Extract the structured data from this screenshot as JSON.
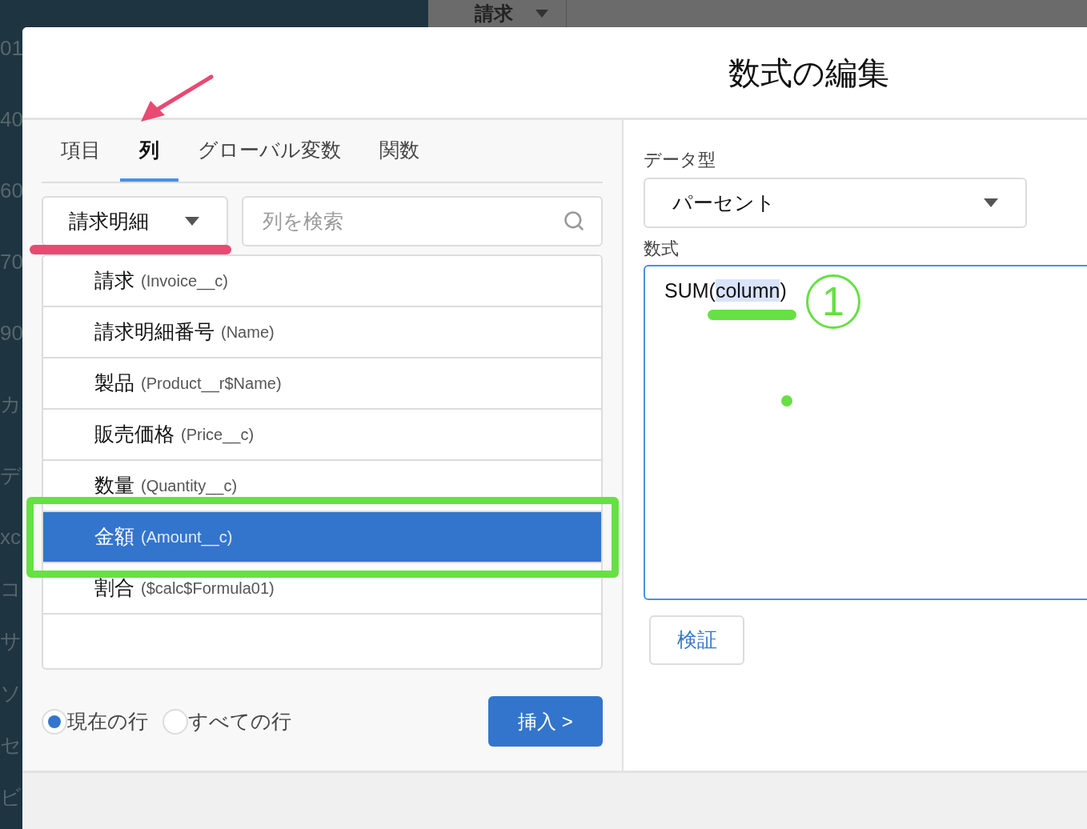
{
  "background": {
    "tab": {
      "label": "請求"
    },
    "side_items": [
      "01",
      "40",
      "60",
      "70",
      "90",
      "カ",
      "デ",
      "xc",
      "コ",
      "サ",
      "ソ",
      "セ",
      "ビ"
    ]
  },
  "dialog": {
    "title": "数式の編集",
    "tabs": [
      {
        "label": "項目",
        "selected": false
      },
      {
        "label": "列",
        "selected": true
      },
      {
        "label": "グローバル変数",
        "selected": false
      },
      {
        "label": "関数",
        "selected": false
      }
    ],
    "object_select": {
      "value": "請求明細"
    },
    "search": {
      "placeholder": "列を検索"
    },
    "columns": [
      {
        "label": "請求",
        "api_name": "(Invoice__c)",
        "selected": false
      },
      {
        "label": "請求明細番号",
        "api_name": "(Name)",
        "selected": false
      },
      {
        "label": "製品",
        "api_name": "(Product__r$Name)",
        "selected": false
      },
      {
        "label": "販売価格",
        "api_name": "(Price__c)",
        "selected": false
      },
      {
        "label": "数量",
        "api_name": "(Quantity__c)",
        "selected": false
      },
      {
        "label": "金額",
        "api_name": "(Amount__c)",
        "selected": true
      },
      {
        "label": "割合",
        "api_name": "($calc$Formula01)",
        "selected": false
      }
    ],
    "row_scope": [
      {
        "label": "現在の行",
        "selected": true
      },
      {
        "label": "すべての行",
        "selected": false
      }
    ],
    "insert_button": "挿入 >",
    "data_type": {
      "label": "データ型",
      "value": "パーセント"
    },
    "formula": {
      "label": "数式",
      "before": "SUM(",
      "selection": "column",
      "after": ")"
    },
    "validate_button": "検証"
  },
  "annotations": {
    "circled_number": "1"
  }
}
